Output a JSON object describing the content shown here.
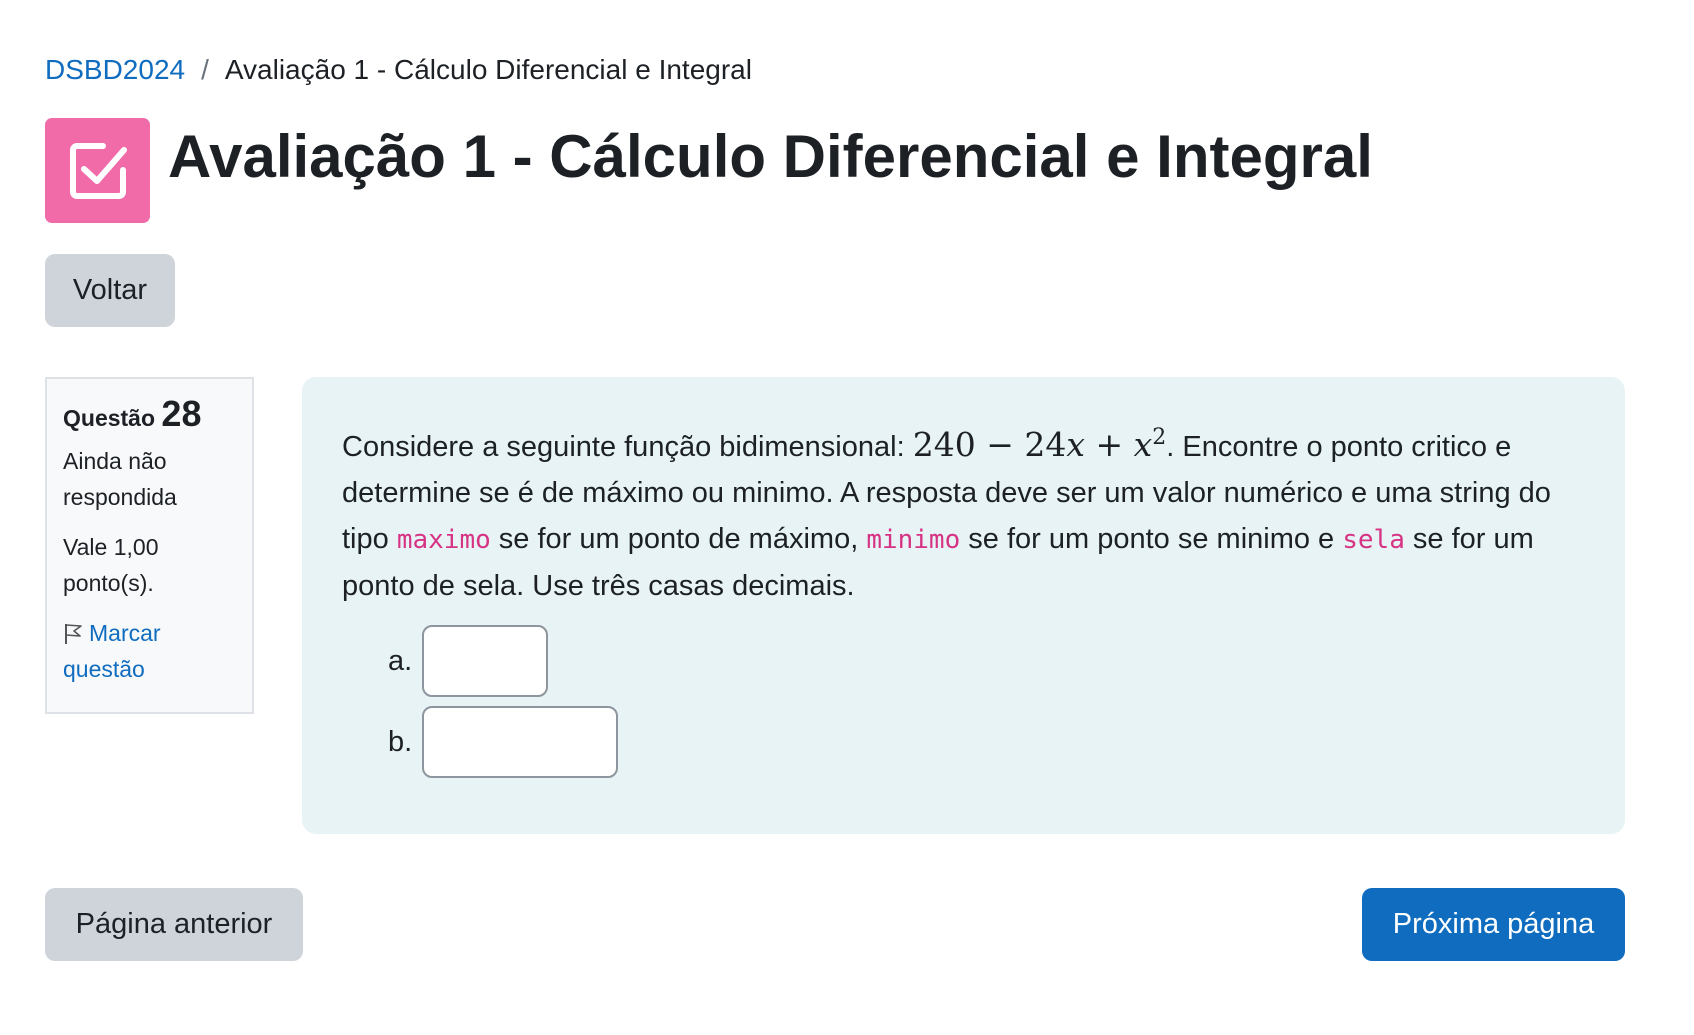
{
  "breadcrumb": {
    "course": "DSBD2024",
    "separator": "/",
    "current": "Avaliação 1 - Cálculo Diferencial e Integral"
  },
  "page": {
    "title": "Avaliação 1 - Cálculo Diferencial e Integral",
    "icon": "checkbox-icon",
    "icon_color": "#f06ba8"
  },
  "buttons": {
    "back": "Voltar",
    "previous": "Página anterior",
    "next": "Próxima página"
  },
  "question_info": {
    "label": "Questão",
    "number": "28",
    "status": "Ainda não respondida",
    "points": "Vale 1,00 ponto(s).",
    "flag": "Marcar questão"
  },
  "question": {
    "intro": "Considere a seguinte função bidimensional: ",
    "formula_const": "240",
    "formula_op1": " − ",
    "formula_coef": "24",
    "formula_var1": "x",
    "formula_op2": " + ",
    "formula_var2": "x",
    "formula_exp": "2",
    "text1": ". Encontre o ponto critico e determine se é de máximo ou minimo. A resposta deve ser um valor numérico e uma string do tipo ",
    "code_max": "maximo",
    "text2": " se for um ponto de máximo, ",
    "code_min": "minimo",
    "text3": " se for um ponto se minimo e ",
    "code_sela": "sela",
    "text4": " se for um ponto de sela. Use três casas decimais.",
    "answers": [
      {
        "label": "a.",
        "value": ""
      },
      {
        "label": "b.",
        "value": ""
      }
    ]
  },
  "colors": {
    "primary": "#0f6cbf",
    "secondary_button": "#ced4da",
    "question_bg": "#e7f3f5",
    "code": "#d63384"
  }
}
